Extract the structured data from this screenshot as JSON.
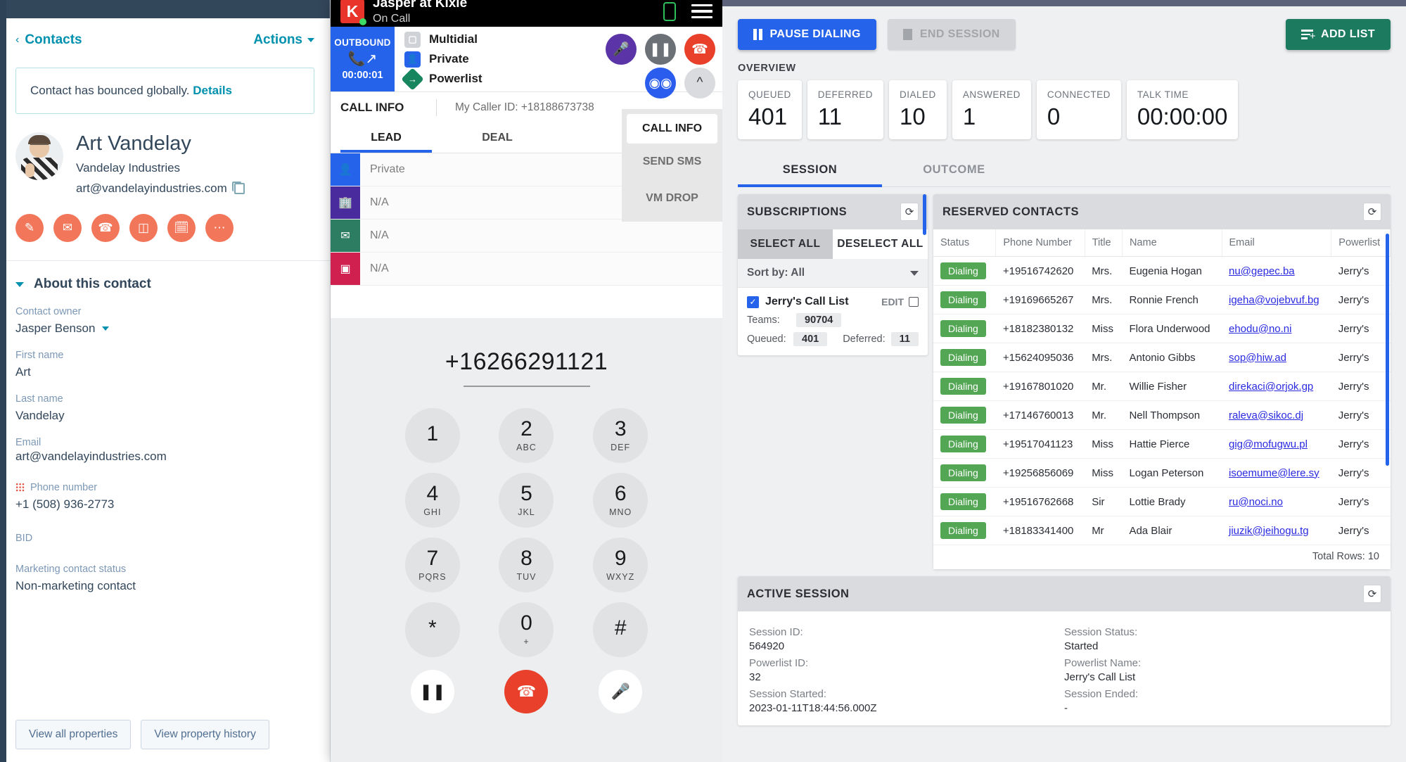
{
  "hubspot": {
    "back_label": "Contacts",
    "actions_label": "Actions",
    "alert_text": "Contact has bounced globally.",
    "alert_link": "Details",
    "contact_name": "Art Vandelay",
    "company": "Vandelay Industries",
    "email": "art@vandelayindustries.com",
    "quick_actions": [
      {
        "name": "note-icon",
        "glyph": "✎"
      },
      {
        "name": "email-icon",
        "glyph": "✉"
      },
      {
        "name": "call-icon",
        "glyph": "☎"
      },
      {
        "name": "log-icon",
        "glyph": "❐"
      },
      {
        "name": "meeting-icon",
        "glyph": "Ὄ5"
      },
      {
        "name": "more-icon",
        "glyph": "⋯"
      }
    ],
    "about_title": "About this contact",
    "fields": [
      {
        "label": "Contact owner",
        "value": "Jasper Benson",
        "dropdown": true
      },
      {
        "label": "First name",
        "value": "Art"
      },
      {
        "label": "Last name",
        "value": "Vandelay"
      },
      {
        "label": "Email",
        "value": "art@vandelayindustries.com"
      },
      {
        "label": "Phone number",
        "value": "+1 (508) 936-2773",
        "dial_icon": true
      },
      {
        "label": "BID",
        "value": ""
      },
      {
        "label": "Marketing contact status",
        "value": "Non-marketing contact"
      }
    ],
    "footer_buttons": [
      "View all properties",
      "View property history"
    ]
  },
  "kixie": {
    "user": "Jasper at Kixie",
    "status": "On Call",
    "direction": "OUTBOUND",
    "timer": "00:00:01",
    "modes": [
      {
        "label": "Multidial",
        "icon": "multidial-icon"
      },
      {
        "label": "Private",
        "icon": "private-icon"
      },
      {
        "label": "Powerlist",
        "icon": "powerlist-icon"
      }
    ],
    "controls": [
      {
        "name": "mute-button",
        "glyph": "Ἲ4"
      },
      {
        "name": "hold-button",
        "glyph": "‖"
      },
      {
        "name": "hangup-button",
        "glyph": "☎"
      },
      {
        "name": "voicemail-button",
        "glyph": "∞"
      },
      {
        "name": "collapse-button",
        "glyph": "⌃"
      }
    ],
    "call_info_label": "CALL INFO",
    "caller_id": "My Caller ID: +18188673738",
    "tabs": [
      {
        "label": "LEAD",
        "active": true
      },
      {
        "label": "DEAL",
        "active": false
      }
    ],
    "lead_rows": [
      {
        "icon": "person-icon",
        "value": "Private"
      },
      {
        "icon": "company-icon",
        "value": "N/A"
      },
      {
        "icon": "email-icon",
        "value": "N/A"
      },
      {
        "icon": "deal-icon",
        "value": "N/A"
      }
    ],
    "side_actions": [
      {
        "label": "CALL INFO",
        "active": true
      },
      {
        "label": "SEND SMS",
        "active": false
      },
      {
        "label": "VM DROP",
        "active": false
      }
    ],
    "dial_number": "+16266291121",
    "keys": [
      {
        "digit": "1",
        "letters": ""
      },
      {
        "digit": "2",
        "letters": "ABC"
      },
      {
        "digit": "3",
        "letters": "DEF"
      },
      {
        "digit": "4",
        "letters": "GHI"
      },
      {
        "digit": "5",
        "letters": "JKL"
      },
      {
        "digit": "6",
        "letters": "MNO"
      },
      {
        "digit": "7",
        "letters": "PQRS"
      },
      {
        "digit": "8",
        "letters": "TUV"
      },
      {
        "digit": "9",
        "letters": "WXYZ"
      },
      {
        "digit": "*",
        "letters": ""
      },
      {
        "digit": "0",
        "letters": "+"
      },
      {
        "digit": "#",
        "letters": ""
      }
    ],
    "bottom_controls": [
      {
        "name": "pad-hold-button",
        "glyph": "‖"
      },
      {
        "name": "pad-hangup-button",
        "glyph": "☎"
      },
      {
        "name": "pad-mic-button",
        "glyph": "Ἲ4"
      }
    ]
  },
  "powerdialer": {
    "buttons": {
      "pause": "PAUSE DIALING",
      "end": "END SESSION",
      "add_list": "ADD LIST"
    },
    "overview_label": "OVERVIEW",
    "overview": [
      {
        "key": "QUEUED",
        "value": "401"
      },
      {
        "key": "DEFERRED",
        "value": "11"
      },
      {
        "key": "DIALED",
        "value": "10"
      },
      {
        "key": "ANSWERED",
        "value": "1"
      },
      {
        "key": "CONNECTED",
        "value": "0"
      },
      {
        "key": "TALK TIME",
        "value": "00:00:00"
      }
    ],
    "tabs": [
      {
        "label": "SESSION",
        "active": true
      },
      {
        "label": "OUTCOME",
        "active": false
      }
    ],
    "subscriptions": {
      "title": "SUBSCRIPTIONS",
      "select_all": "SELECT ALL",
      "deselect_all": "DESELECT ALL",
      "sort_by": "Sort by: All",
      "item": {
        "name": "Jerry's Call List",
        "edit_label": "EDIT",
        "teams_label": "Teams:",
        "teams_value": "90704",
        "queued_label": "Queued:",
        "queued_value": "401",
        "deferred_label": "Deferred:",
        "deferred_value": "11"
      }
    },
    "reserved": {
      "title": "RESERVED CONTACTS",
      "columns": [
        "Status",
        "Phone Number",
        "Title",
        "Name",
        "Email",
        "Powerlist"
      ],
      "rows": [
        {
          "status": "Dialing",
          "phone": "+19516742620",
          "title": "Mrs.",
          "name": "Eugenia Hogan",
          "email": "nu@gepec.ba",
          "powerlist": "Jerry's"
        },
        {
          "status": "Dialing",
          "phone": "+19169665267",
          "title": "Mrs.",
          "name": "Ronnie French",
          "email": "igeha@vojebvuf.bg",
          "powerlist": "Jerry's"
        },
        {
          "status": "Dialing",
          "phone": "+18182380132",
          "title": "Miss",
          "name": "Flora Underwood",
          "email": "ehodu@no.ni",
          "powerlist": "Jerry's"
        },
        {
          "status": "Dialing",
          "phone": "+15624095036",
          "title": "Mrs.",
          "name": "Antonio Gibbs",
          "email": "sop@hiw.ad",
          "powerlist": "Jerry's"
        },
        {
          "status": "Dialing",
          "phone": "+19167801020",
          "title": "Mr.",
          "name": "Willie Fisher",
          "email": "direkaci@orjok.gp",
          "powerlist": "Jerry's"
        },
        {
          "status": "Dialing",
          "phone": "+17146760013",
          "title": "Mr.",
          "name": "Nell Thompson",
          "email": "raleva@sikoc.dj",
          "powerlist": "Jerry's"
        },
        {
          "status": "Dialing",
          "phone": "+19517041123",
          "title": "Miss",
          "name": "Hattie Pierce",
          "email": "gig@mofugwu.pl",
          "powerlist": "Jerry's"
        },
        {
          "status": "Dialing",
          "phone": "+19256856069",
          "title": "Miss",
          "name": "Logan Peterson",
          "email": "isoemume@lere.sy",
          "powerlist": "Jerry's"
        },
        {
          "status": "Dialing",
          "phone": "+19516762668",
          "title": "Sir",
          "name": "Lottie Brady",
          "email": "ru@noci.no",
          "powerlist": "Jerry's"
        },
        {
          "status": "Dialing",
          "phone": "+18183341400",
          "title": "Mr",
          "name": "Ada Blair",
          "email": "jiuzik@jeihogu.tg",
          "powerlist": "Jerry's"
        }
      ],
      "total_rows": "Total Rows: 10"
    },
    "active_session": {
      "title": "ACTIVE SESSION",
      "pairs": [
        {
          "label": "Session ID:",
          "value": "564920"
        },
        {
          "label": "Session Status:",
          "value": "Started"
        },
        {
          "label": "Powerlist ID:",
          "value": "32"
        },
        {
          "label": "Powerlist Name:",
          "value": "Jerry's Call List"
        },
        {
          "label": "Session Started:",
          "value": "2023-01-11T18:44:56.000Z"
        },
        {
          "label": "Session Ended:",
          "value": "-"
        }
      ]
    }
  }
}
